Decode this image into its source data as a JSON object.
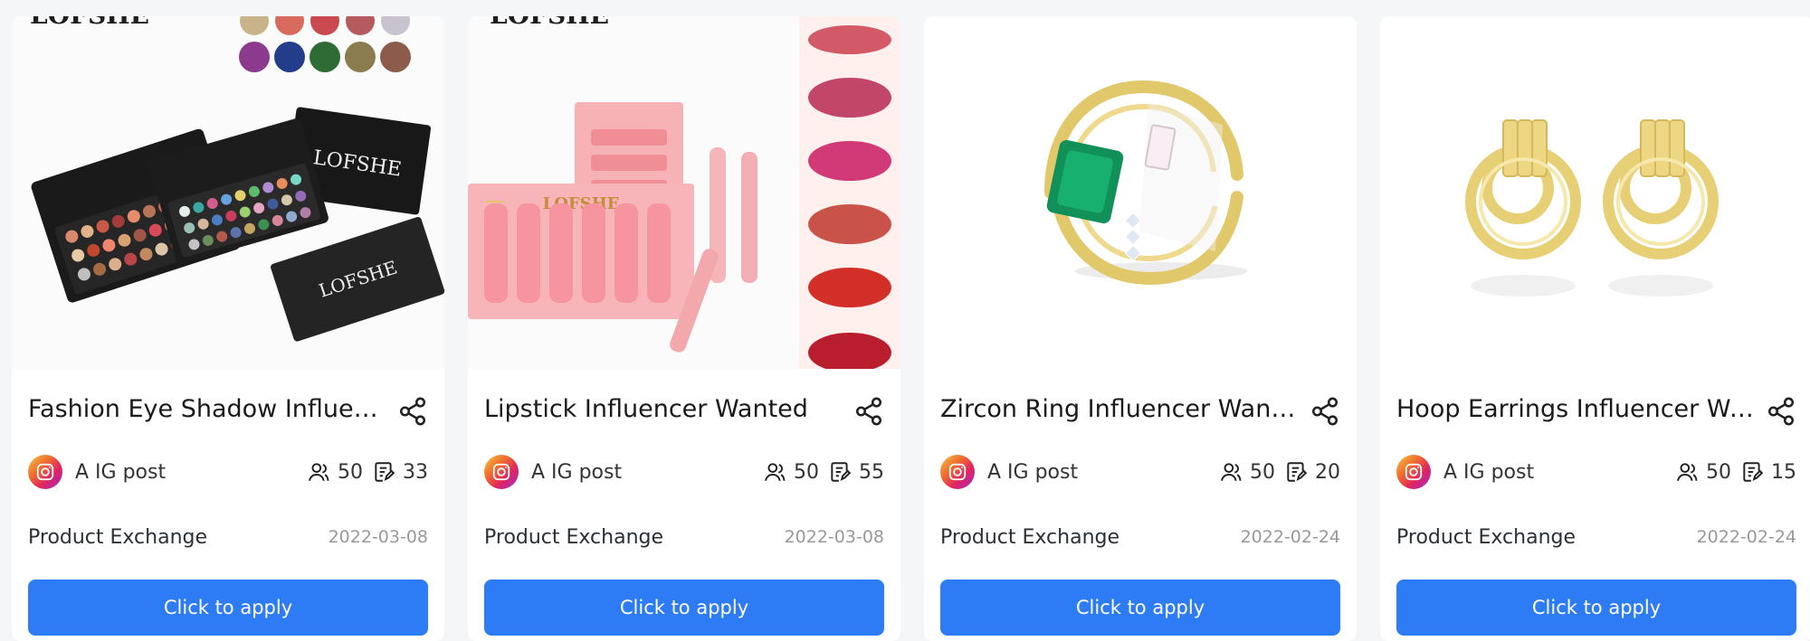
{
  "cards": [
    {
      "title": "Fashion Eye Shadow Influenc...",
      "image_alt": "LOFSHE eye shadow palettes product image",
      "platform": {
        "icon": "instagram-icon",
        "label": "A IG post"
      },
      "stats": {
        "influencers": "50",
        "posts": "33"
      },
      "exchange": "Product Exchange",
      "date": "2022-03-08",
      "button_label": "Click to apply",
      "brand": "LOFSHE"
    },
    {
      "title": "Lipstick Influencer Wanted",
      "image_alt": "LOFSHE matte lip gloss set product image",
      "platform": {
        "icon": "instagram-icon",
        "label": "A IG post"
      },
      "stats": {
        "influencers": "50",
        "posts": "55"
      },
      "exchange": "Product Exchange",
      "date": "2022-03-08",
      "button_label": "Click to apply",
      "brand": "LOFSHE"
    },
    {
      "title": "Zircon Ring Influencer Want...",
      "image_alt": "Gold zircon ring with green stone",
      "platform": {
        "icon": "instagram-icon",
        "label": "A IG post"
      },
      "stats": {
        "influencers": "50",
        "posts": "20"
      },
      "exchange": "Product Exchange",
      "date": "2022-02-24",
      "button_label": "Click to apply"
    },
    {
      "title": "Hoop Earrings Influencer Wa...",
      "image_alt": "Gold hoop earrings",
      "platform": {
        "icon": "instagram-icon",
        "label": "A IG post"
      },
      "stats": {
        "influencers": "50",
        "posts": "15"
      },
      "exchange": "Product Exchange",
      "date": "2022-02-24",
      "button_label": "Click to apply"
    }
  ],
  "colors": {
    "primary": "#2e7bf6",
    "background": "#f5f6f8",
    "card": "#ffffff",
    "muted_text": "#999999"
  },
  "icons": {
    "share": "share-icon",
    "influencers": "people-icon",
    "posts": "edit-note-icon",
    "platform": "instagram-icon"
  }
}
